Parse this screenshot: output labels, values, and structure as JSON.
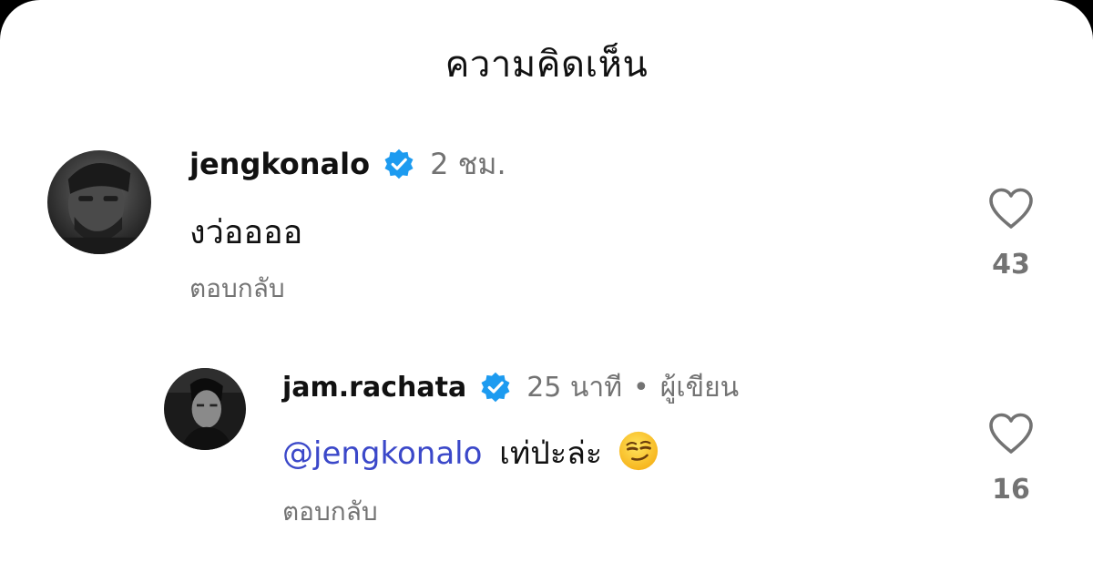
{
  "sheet": {
    "title": "ความคิดเห็น"
  },
  "comments": [
    {
      "username": "jengkonalo",
      "verified": true,
      "timestamp": "2 ชม.",
      "text": "งว่ออออ",
      "reply_label": "ตอบกลับ",
      "like_count": "43"
    }
  ],
  "replies": [
    {
      "username": "jam.rachata",
      "verified": true,
      "timestamp": "25 นาที",
      "separator": "•",
      "author_label": "ผู้เขียน",
      "mention": "@jengkonalo",
      "text": "เท่ป่ะล่ะ",
      "emoji": "smirking-face",
      "reply_label": "ตอบกลับ",
      "like_count": "16"
    }
  ],
  "colors": {
    "verified_badge": "#1d9bf0",
    "mention": "#3b48c9",
    "secondary_text": "#737373"
  }
}
